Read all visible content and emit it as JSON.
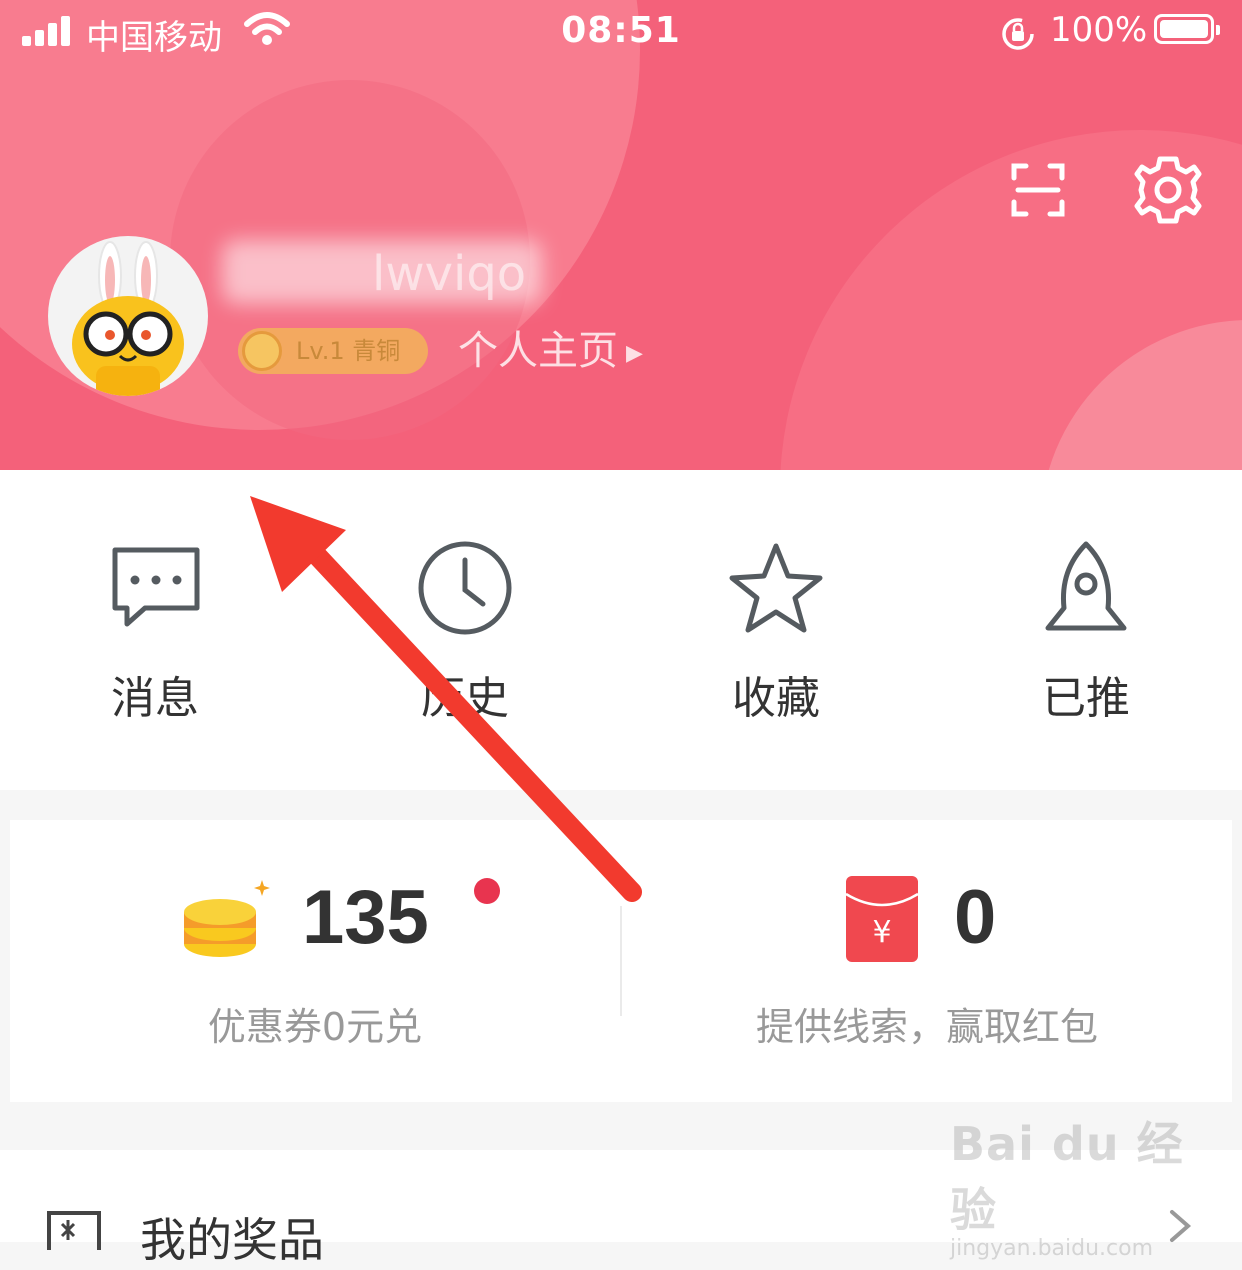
{
  "status_bar": {
    "carrier": "中国移动",
    "time": "08:51",
    "battery": "100%"
  },
  "profile": {
    "username_visible": "lwviqo",
    "level": "Lv.1 青铜",
    "profile_link": "个人主页"
  },
  "quick_nav": [
    {
      "label": "消息",
      "icon": "message-icon"
    },
    {
      "label": "历史",
      "icon": "clock-icon"
    },
    {
      "label": "收藏",
      "icon": "star-icon"
    },
    {
      "label": "已推",
      "icon": "rocket-icon"
    }
  ],
  "rewards": {
    "coins": {
      "value": "135",
      "subtitle": "优惠券0元兑",
      "has_notification_dot": true
    },
    "red_envelope": {
      "value": "0",
      "symbol": "¥",
      "subtitle": "提供线索，赢取红包"
    }
  },
  "menu": {
    "prize_label": "我的奖品"
  },
  "watermark": {
    "brand": "Bai du 经验",
    "url": "jingyan.baidu.com"
  },
  "colors": {
    "header_pink": "#f4617a",
    "annotation_red": "#f23a2e",
    "coin_yellow": "#f9c91f",
    "envelope_red": "#f0484f"
  }
}
